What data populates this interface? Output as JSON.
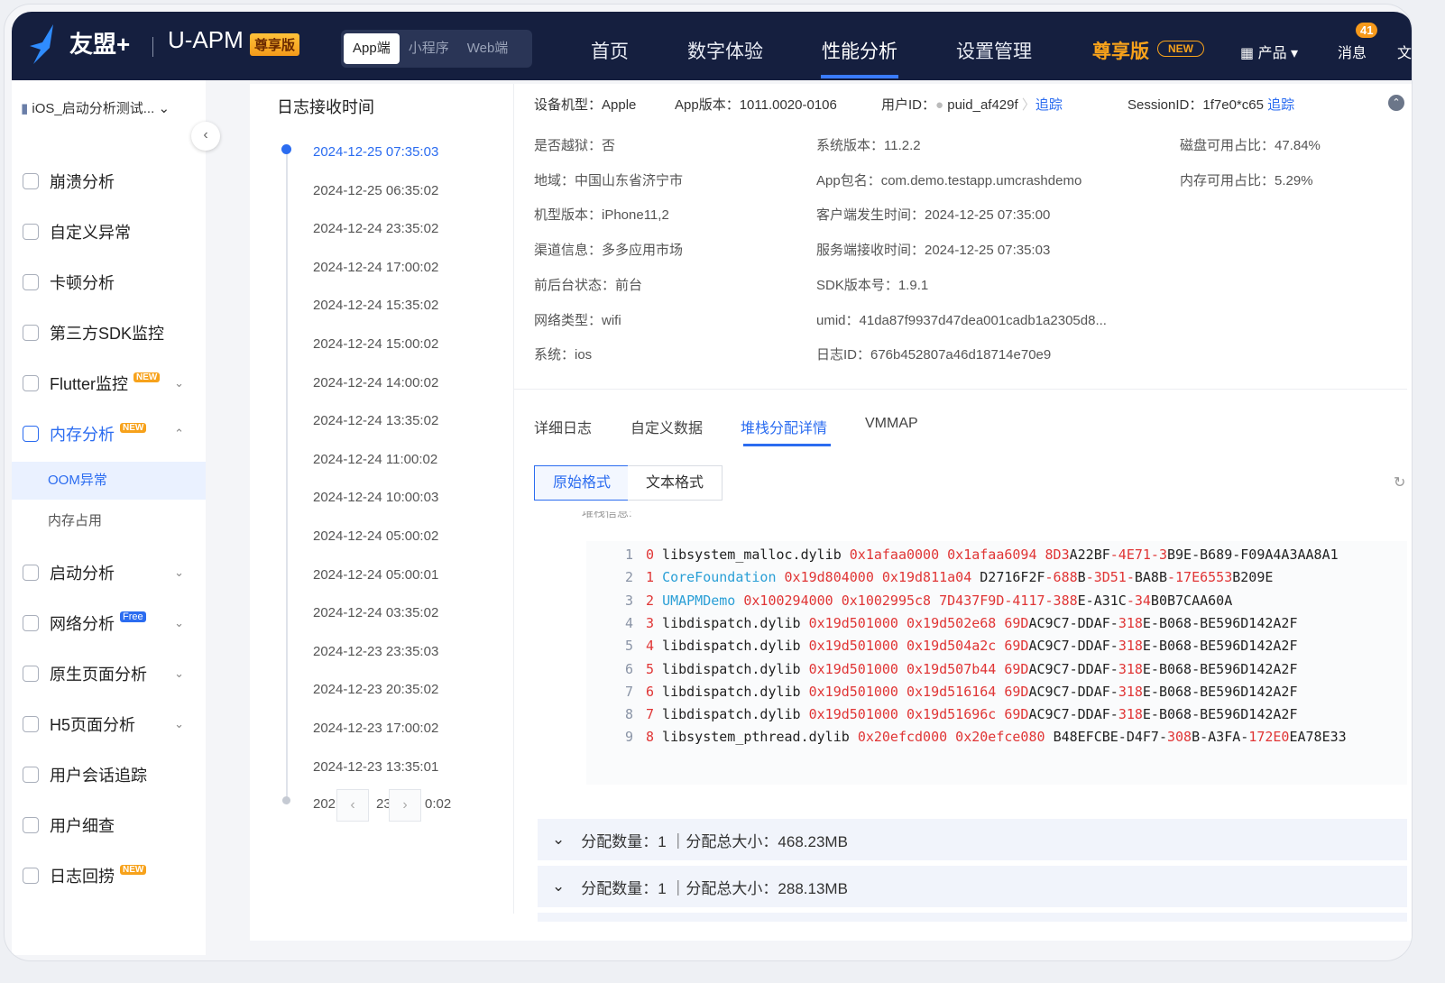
{
  "header": {
    "logo": "友盟+",
    "brand": "U-APM",
    "vip_badge": "尊享版",
    "platforms": [
      "App端",
      "小程序",
      "Web端"
    ],
    "nav": [
      "首页",
      "数字体验",
      "性能分析",
      "设置管理"
    ],
    "premium": "尊享版",
    "premium_badge": "NEW",
    "products": "产品",
    "messages": "消息",
    "message_count": "41",
    "docs": "文"
  },
  "sidebar": {
    "app": "iOS_启动分析测试...",
    "items": [
      {
        "label": "崩溃分析"
      },
      {
        "label": "自定义异常"
      },
      {
        "label": "卡顿分析"
      },
      {
        "label": "第三方SDK监控"
      },
      {
        "label": "Flutter监控",
        "badge": "NEW"
      },
      {
        "label": "内存分析",
        "badge": "NEW"
      },
      {
        "label": "启动分析"
      },
      {
        "label": "网络分析",
        "badge": "Free"
      },
      {
        "label": "原生页面分析"
      },
      {
        "label": "H5页面分析"
      },
      {
        "label": "用户会话追踪"
      },
      {
        "label": "用户细查"
      },
      {
        "label": "日志回捞",
        "badge": "NEW"
      }
    ],
    "sub": [
      "OOM异常",
      "内存占用"
    ]
  },
  "timeline": {
    "title": "日志接收时间",
    "items": [
      "2024-12-25 07:35:03",
      "2024-12-25 06:35:02",
      "2024-12-24 23:35:02",
      "2024-12-24 17:00:02",
      "2024-12-24 15:35:02",
      "2024-12-24 15:00:02",
      "2024-12-24 14:00:02",
      "2024-12-24 13:35:02",
      "2024-12-24 11:00:02",
      "2024-12-24 10:00:03",
      "2024-12-24 05:00:02",
      "2024-12-24 05:00:01",
      "2024-12-24 03:35:02",
      "2024-12-23 23:35:03",
      "2024-12-23 20:35:02",
      "2024-12-23 17:00:02",
      "2024-12-23 13:35:01"
    ],
    "last_partial_left": "202",
    "last_partial_mid": "23",
    "last_partial_right": "0:02"
  },
  "info": {
    "device_label": "设备机型：",
    "device": "Apple",
    "appver_label": "App版本：",
    "appver": "1011.0020-0106",
    "uid_label": "用户ID：",
    "uid": "puid_af429f",
    "track": "追踪",
    "sid_label": "SessionID：",
    "sid": "1f7e0*c65",
    "rows": [
      [
        "是否越狱：否",
        "系统版本：11.2.2",
        "磁盘可用占比：47.84%"
      ],
      [
        "地域：中国山东省济宁市",
        "App包名：com.demo.testapp.umcrashdemo",
        "内存可用占比：5.29%"
      ],
      [
        "机型版本：iPhone11,2",
        "客户端发生时间：2024-12-25 07:35:00",
        ""
      ],
      [
        "渠道信息：多多应用市场",
        "服务端接收时间：2024-12-25 07:35:03",
        ""
      ],
      [
        "前后台状态：前台",
        "SDK版本号：1.9.1",
        ""
      ],
      [
        "网络类型：wifi",
        "umid：41da87f9937d47dea001cadb1a2305d8...",
        ""
      ],
      [
        "系统：ios",
        "日志ID：676b452807a46d18714e70e9",
        ""
      ]
    ]
  },
  "tabs": [
    "详细日志",
    "自定义数据",
    "堆栈分配详情",
    "VMMAP"
  ],
  "formats": [
    "原始格式",
    "文本格式"
  ],
  "stack_label": "堆栈信息:",
  "code": [
    [
      [
        "0",
        "r"
      ],
      [
        " libsystem_malloc.dylib ",
        "d"
      ],
      [
        "0x1afaa0000 0x1afaa6094 8D3",
        "r"
      ],
      [
        "A22BF",
        "d"
      ],
      [
        "-4E71-3",
        "r"
      ],
      [
        "B9E-B689-F09A4A3AA8A1",
        "d"
      ]
    ],
    [
      [
        "1 ",
        "r"
      ],
      [
        "CoreFoundation ",
        "b"
      ],
      [
        "0x19d804000 0x19d811a04 ",
        "r"
      ],
      [
        "D2716F2F",
        "d"
      ],
      [
        "-688",
        "r"
      ],
      [
        "B",
        "d"
      ],
      [
        "-3D51-",
        "r"
      ],
      [
        "BA8B",
        "d"
      ],
      [
        "-17E6553",
        "r"
      ],
      [
        "B209E",
        "d"
      ]
    ],
    [
      [
        "2 ",
        "r"
      ],
      [
        "UMAPMDemo ",
        "b"
      ],
      [
        "0x100294000 0x1002995c8 7D437F9D-4117-388",
        "r"
      ],
      [
        "E-A31C",
        "d"
      ],
      [
        "-34",
        "r"
      ],
      [
        "B0B7CAA60A",
        "d"
      ]
    ],
    [
      [
        "3",
        "r"
      ],
      [
        " libdispatch.dylib ",
        "d"
      ],
      [
        "0x19d501000 0x19d502e68 69D",
        "r"
      ],
      [
        "AC9C7-DDAF-",
        "d"
      ],
      [
        "318",
        "r"
      ],
      [
        "E-B068-BE596D142A2F",
        "d"
      ]
    ],
    [
      [
        "4",
        "r"
      ],
      [
        " libdispatch.dylib ",
        "d"
      ],
      [
        "0x19d501000 0x19d504a2c 69D",
        "r"
      ],
      [
        "AC9C7-DDAF-",
        "d"
      ],
      [
        "318",
        "r"
      ],
      [
        "E-B068-BE596D142A2F",
        "d"
      ]
    ],
    [
      [
        "5",
        "r"
      ],
      [
        " libdispatch.dylib ",
        "d"
      ],
      [
        "0x19d501000 0x19d507b44 69D",
        "r"
      ],
      [
        "AC9C7-DDAF-",
        "d"
      ],
      [
        "318",
        "r"
      ],
      [
        "E-B068-BE596D142A2F",
        "d"
      ]
    ],
    [
      [
        "6",
        "r"
      ],
      [
        " libdispatch.dylib ",
        "d"
      ],
      [
        "0x19d501000 0x19d516164 69D",
        "r"
      ],
      [
        "AC9C7-DDAF-",
        "d"
      ],
      [
        "318",
        "r"
      ],
      [
        "E-B068-BE596D142A2F",
        "d"
      ]
    ],
    [
      [
        "7",
        "r"
      ],
      [
        " libdispatch.dylib ",
        "d"
      ],
      [
        "0x19d501000 0x19d51696c 69D",
        "r"
      ],
      [
        "AC9C7-DDAF-",
        "d"
      ],
      [
        "318",
        "r"
      ],
      [
        "E-B068-BE596D142A2F",
        "d"
      ]
    ],
    [
      [
        "8",
        "r"
      ],
      [
        " libsystem_pthread.dylib ",
        "d"
      ],
      [
        "0x20efcd000 0x20efce080 ",
        "r"
      ],
      [
        "B48EFCBE-D4F7-",
        "d"
      ],
      [
        "308",
        "r"
      ],
      [
        "B-A3FA-",
        "d"
      ],
      [
        "172E0",
        "r"
      ],
      [
        "EA78E33",
        "d"
      ]
    ]
  ],
  "allocations": [
    "分配数量：1 ｜分配总大小：468.23MB",
    "分配数量：1 ｜分配总大小：288.13MB"
  ],
  "colors": {
    "header_bg": "#151f3f",
    "accent": "#2b6cf0",
    "premium": "#f7a21b",
    "code_red": "#e03535"
  }
}
